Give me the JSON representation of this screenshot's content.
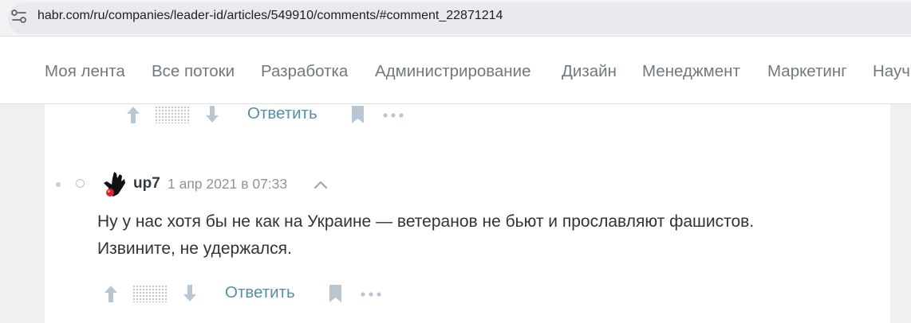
{
  "browser": {
    "url": "habr.com/ru/companies/leader-id/articles/549910/comments/#comment_22871214"
  },
  "nav": {
    "items": [
      "Моя лента",
      "Все потоки",
      "Разработка",
      "Администрирование",
      "Дизайн",
      "Менеджмент",
      "Маркетинг",
      "Научпоп"
    ]
  },
  "prev_comment": {
    "reply_label": "Ответить"
  },
  "comment": {
    "author": "up7",
    "timestamp": "1 апр 2021 в 07:33",
    "text_lines": [
      "Ну у нас хотя бы не как на Украине — ветеранов не бьют и прославляют фашистов.",
      "Извините, не удержался."
    ],
    "reply_label": "Ответить"
  },
  "colors": {
    "accent": "#548eaa",
    "icon": "#b9c6d2",
    "nav_text": "#71797e"
  }
}
